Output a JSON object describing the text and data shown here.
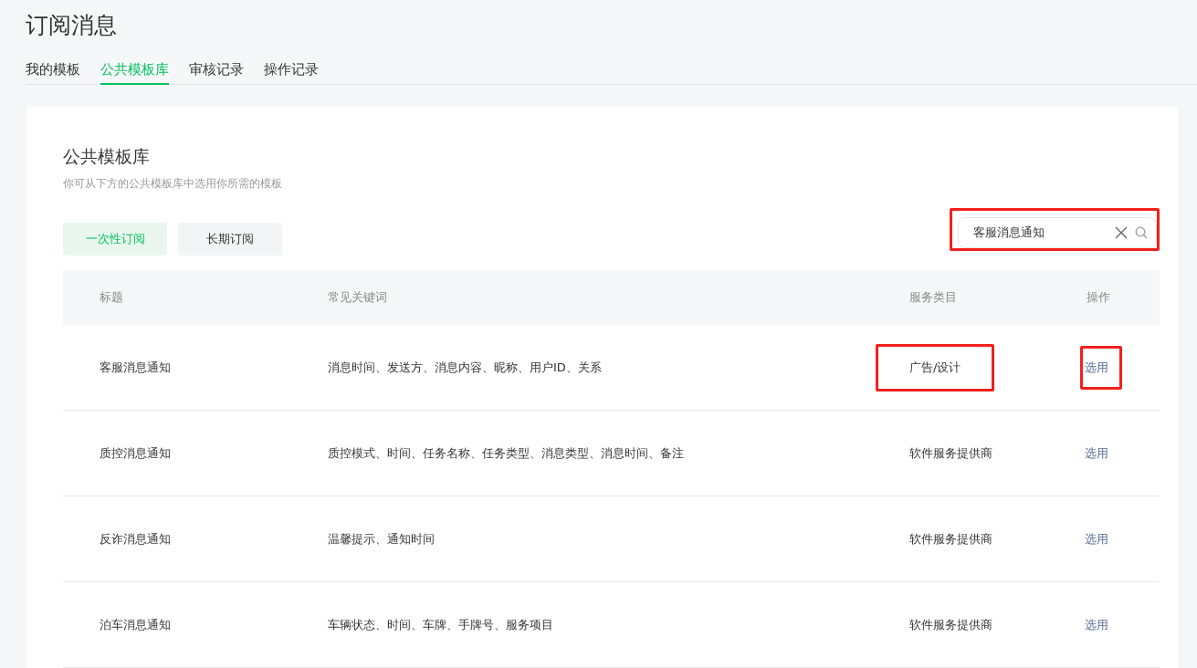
{
  "page_title": "订阅消息",
  "tabs": [
    {
      "label": "我的模板",
      "selected": false
    },
    {
      "label": "公共模板库",
      "selected": true
    },
    {
      "label": "审核记录",
      "selected": false
    },
    {
      "label": "操作记录",
      "selected": false
    }
  ],
  "panel": {
    "title": "公共模板库",
    "subtitle": "你可从下方的公共模板库中选用你所需的模板"
  },
  "filters": [
    {
      "label": "一次性订阅",
      "selected": true
    },
    {
      "label": "长期订阅",
      "selected": false
    }
  ],
  "search": {
    "value": "客服消息通知",
    "highlighted": true
  },
  "table": {
    "columns": [
      "标题",
      "常见关键词",
      "服务类目",
      "操作"
    ],
    "rows": [
      {
        "title": "客服消息通知",
        "keywords": "消息时间、发送方、消息内容、昵称、用户ID、关系",
        "category": "广告/设计",
        "action": "选用",
        "category_highlighted": true,
        "action_highlighted": true
      },
      {
        "title": "质控消息通知",
        "keywords": "质控模式、时间、任务名称、任务类型、消息类型、消息时间、备注",
        "category": "软件服务提供商",
        "action": "选用",
        "category_highlighted": false,
        "action_highlighted": false
      },
      {
        "title": "反诈消息通知",
        "keywords": "温馨提示、通知时间",
        "category": "软件服务提供商",
        "action": "选用",
        "category_highlighted": false,
        "action_highlighted": false
      },
      {
        "title": "泊车消息通知",
        "keywords": "车辆状态、时间、车牌、手牌号、服务项目",
        "category": "软件服务提供商",
        "action": "选用",
        "category_highlighted": false,
        "action_highlighted": false
      }
    ]
  }
}
